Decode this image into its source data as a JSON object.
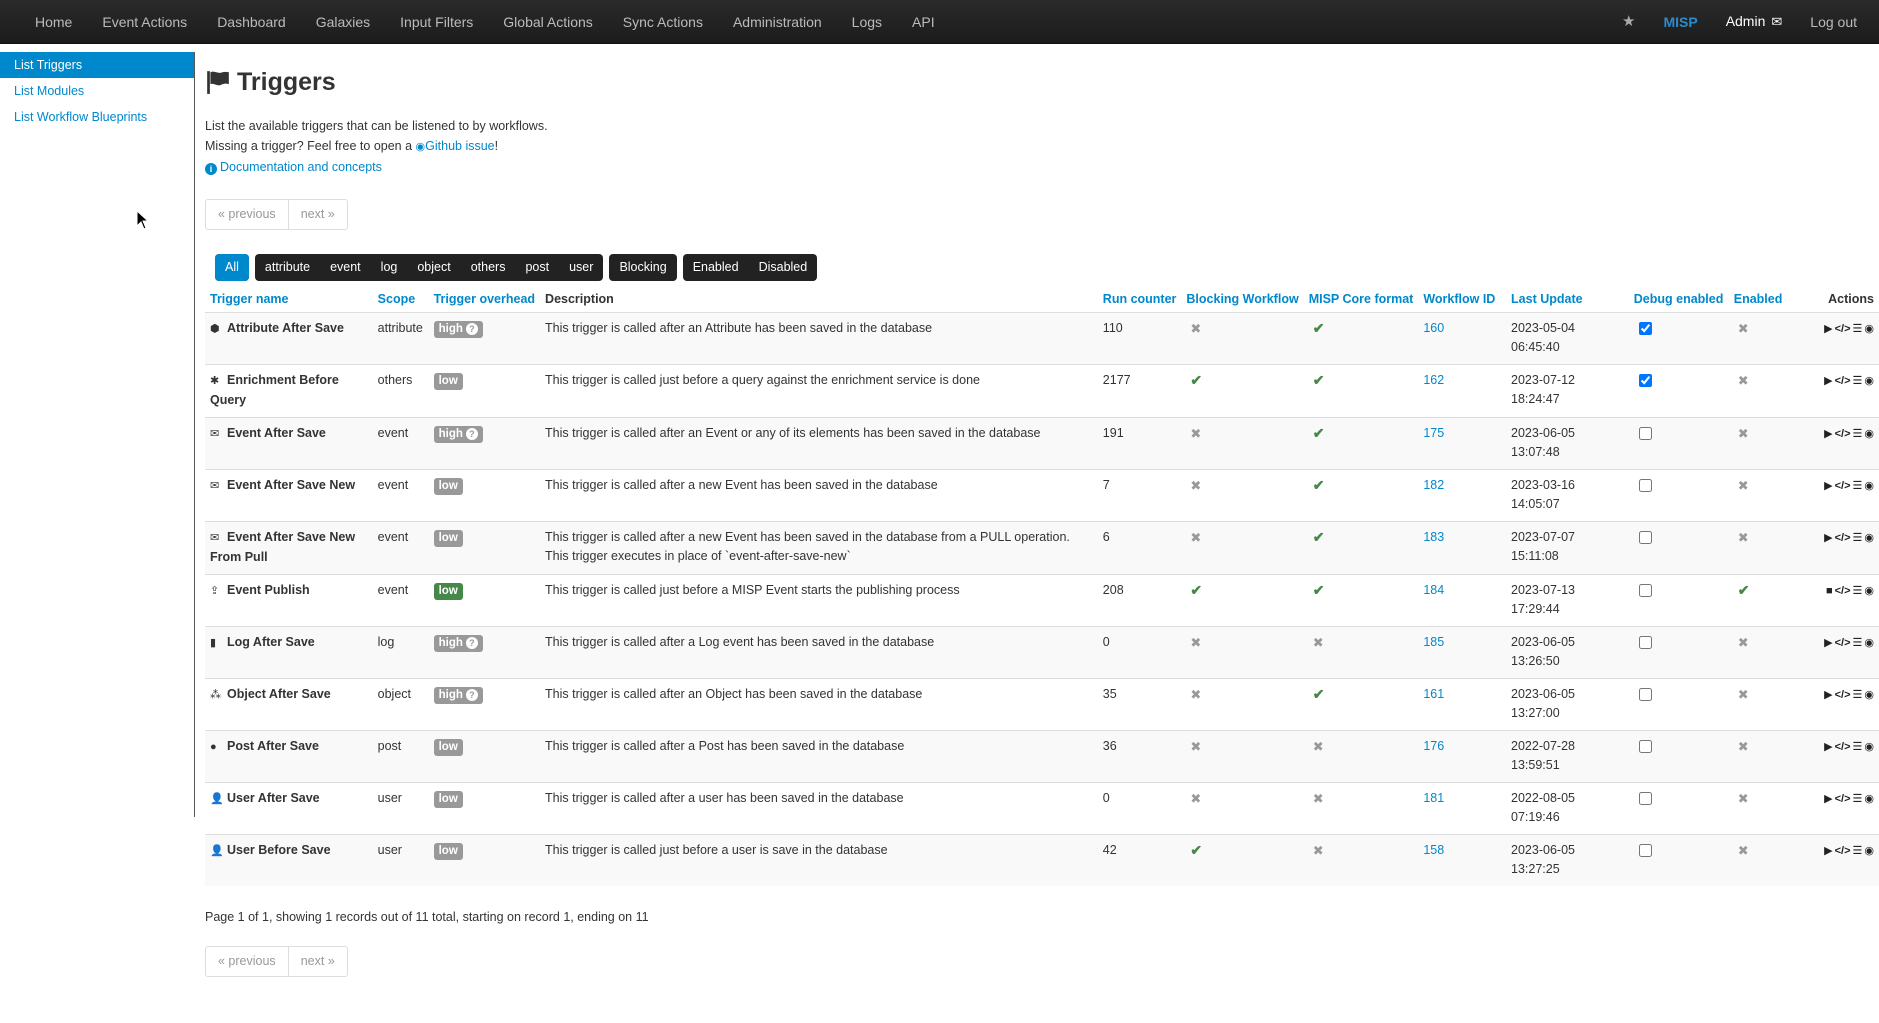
{
  "nav": {
    "items": [
      "Home",
      "Event Actions",
      "Dashboard",
      "Galaxies",
      "Input Filters",
      "Global Actions",
      "Sync Actions",
      "Administration",
      "Logs",
      "API"
    ],
    "brand": "MISP",
    "user": "Admin",
    "logout": "Log out"
  },
  "sidebar": {
    "items": [
      {
        "label": "List Triggers",
        "active": true
      },
      {
        "label": "List Modules",
        "active": false
      },
      {
        "label": "List Workflow Blueprints",
        "active": false
      }
    ]
  },
  "page": {
    "title": "Triggers",
    "intro1": "List the available triggers that can be listened to by workflows.",
    "intro2_pre": "Missing a trigger? Feel free to open a",
    "github_link": "Github issue",
    "intro2_post": "!",
    "docs_link": "Documentation and concepts"
  },
  "pager": {
    "previous": "« previous",
    "next": "next »"
  },
  "filters": {
    "groups": [
      [
        "All"
      ],
      [
        "attribute",
        "event",
        "log",
        "object",
        "others",
        "post",
        "user"
      ],
      [
        "Blocking"
      ],
      [
        "Enabled",
        "Disabled"
      ]
    ],
    "active": "All"
  },
  "table": {
    "headers": [
      "Trigger name",
      "Scope",
      "Trigger overhead",
      "Description",
      "Run counter",
      "Blocking Workflow",
      "MISP Core format",
      "Workflow ID",
      "Last Update",
      "Debug enabled",
      "Enabled",
      "Actions"
    ],
    "rows": [
      {
        "name": "Attribute After Save",
        "icon": "cube-icon",
        "scope": "attribute",
        "overhead": "high",
        "description": "This trigger is called after an Attribute has been saved in the database",
        "run_counter": "110",
        "blocking": false,
        "core_format": true,
        "workflow_id": "160",
        "last_update": "2023-05-04 06:45:40",
        "debug": true,
        "enabled": false
      },
      {
        "name": "Enrichment Before Query",
        "icon": "asterisk-icon",
        "scope": "others",
        "overhead": "low",
        "description": "This trigger is called just before a query against the enrichment service is done",
        "run_counter": "2177",
        "blocking": true,
        "core_format": true,
        "workflow_id": "162",
        "last_update": "2023-07-12 18:24:47",
        "debug": true,
        "enabled": false
      },
      {
        "name": "Event After Save",
        "icon": "envelope-icon",
        "scope": "event",
        "overhead": "high",
        "description": "This trigger is called after an Event or any of its elements has been saved in the database",
        "run_counter": "191",
        "blocking": false,
        "core_format": true,
        "workflow_id": "175",
        "last_update": "2023-06-05 13:07:48",
        "debug": false,
        "enabled": false
      },
      {
        "name": "Event After Save New",
        "icon": "envelope-icon",
        "scope": "event",
        "overhead": "low",
        "description": "This trigger is called after a new Event has been saved in the database",
        "run_counter": "7",
        "blocking": false,
        "core_format": true,
        "workflow_id": "182",
        "last_update": "2023-03-16 14:05:07",
        "debug": false,
        "enabled": false
      },
      {
        "name": "Event After Save New From Pull",
        "icon": "envelope-icon",
        "scope": "event",
        "overhead": "low",
        "description": "This trigger is called after a new Event has been saved in the database from a PULL operation. This trigger executes in place of `event-after-save-new`",
        "run_counter": "6",
        "blocking": false,
        "core_format": true,
        "workflow_id": "183",
        "last_update": "2023-07-07 15:11:08",
        "debug": false,
        "enabled": false
      },
      {
        "name": "Event Publish",
        "icon": "upload-icon",
        "scope": "event",
        "overhead": "low",
        "overhead_green": true,
        "description": "This trigger is called just before a MISP Event starts the publishing process",
        "run_counter": "208",
        "blocking": true,
        "core_format": true,
        "workflow_id": "184",
        "last_update": "2023-07-13 17:29:44",
        "debug": false,
        "enabled": true
      },
      {
        "name": "Log After Save",
        "icon": "file-icon",
        "scope": "log",
        "overhead": "high",
        "description": "This trigger is called after a Log event has been saved in the database",
        "run_counter": "0",
        "blocking": false,
        "core_format": false,
        "workflow_id": "185",
        "last_update": "2023-06-05 13:26:50",
        "debug": false,
        "enabled": false
      },
      {
        "name": "Object After Save",
        "icon": "cubes-icon",
        "scope": "object",
        "overhead": "high",
        "description": "This trigger is called after an Object has been saved in the database",
        "run_counter": "35",
        "blocking": false,
        "core_format": true,
        "workflow_id": "161",
        "last_update": "2023-06-05 13:27:00",
        "debug": false,
        "enabled": false
      },
      {
        "name": "Post After Save",
        "icon": "comment-icon",
        "scope": "post",
        "overhead": "low",
        "description": "This trigger is called after a Post has been saved in the database",
        "run_counter": "36",
        "blocking": false,
        "core_format": false,
        "workflow_id": "176",
        "last_update": "2022-07-28 13:59:51",
        "debug": false,
        "enabled": false
      },
      {
        "name": "User After Save",
        "icon": "user-edit-icon",
        "scope": "user",
        "overhead": "low",
        "description": "This trigger is called after a user has been saved in the database",
        "run_counter": "0",
        "blocking": false,
        "core_format": false,
        "workflow_id": "181",
        "last_update": "2022-08-05 07:19:46",
        "debug": false,
        "enabled": false
      },
      {
        "name": "User Before Save",
        "icon": "user-plus-icon",
        "scope": "user",
        "overhead": "low",
        "description": "This trigger is called just before a user is save in the database",
        "run_counter": "42",
        "blocking": true,
        "core_format": false,
        "workflow_id": "158",
        "last_update": "2023-06-05 13:27:25",
        "debug": false,
        "enabled": false
      }
    ]
  },
  "summary": "Page 1 of 1, showing 1 records out of 11 total, starting on record 1, ending on 11",
  "colors": {
    "accent": "#0088cc",
    "success": "#468847",
    "navbar": "#222222"
  }
}
